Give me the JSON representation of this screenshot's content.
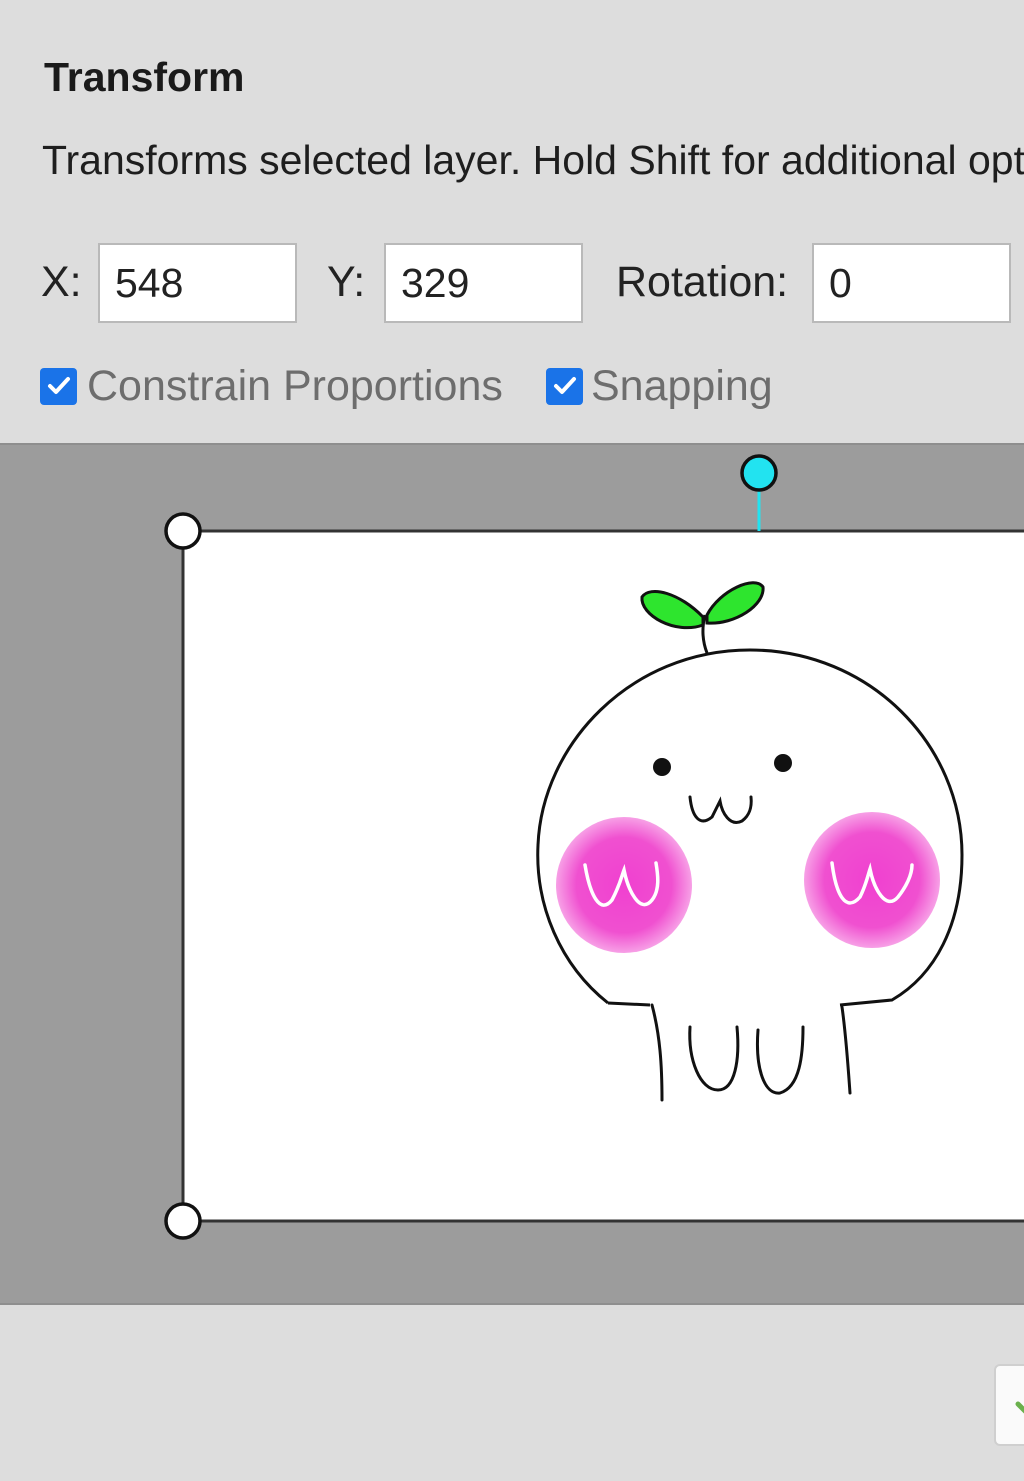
{
  "dialog": {
    "title": "Transform",
    "description": "Transforms selected layer. Hold Shift for additional options."
  },
  "fields": {
    "x_label": "X:",
    "x_value": "548",
    "y_label": "Y:",
    "y_value": "329",
    "rotation_label": "Rotation:",
    "rotation_value": "0"
  },
  "options": {
    "constrain_label": "Constrain Proportions",
    "constrain_checked": true,
    "snapping_label": "Snapping",
    "snapping_checked": true
  },
  "canvas": {
    "icons": {
      "corner_handle": "circle-handle-icon",
      "rotate_handle": "rotate-handle-icon",
      "layer_content": "sprout-character-illustration"
    },
    "colors": {
      "workspace": "#9c9c9c",
      "layer_background": "#ffffff",
      "rotate_handle": "#22e3f0",
      "leaf": "#2ee52e",
      "blush": "#f050d0"
    }
  },
  "footer": {
    "ok_icon": "checkmark-icon",
    "ok_color": "#6ab04c"
  }
}
